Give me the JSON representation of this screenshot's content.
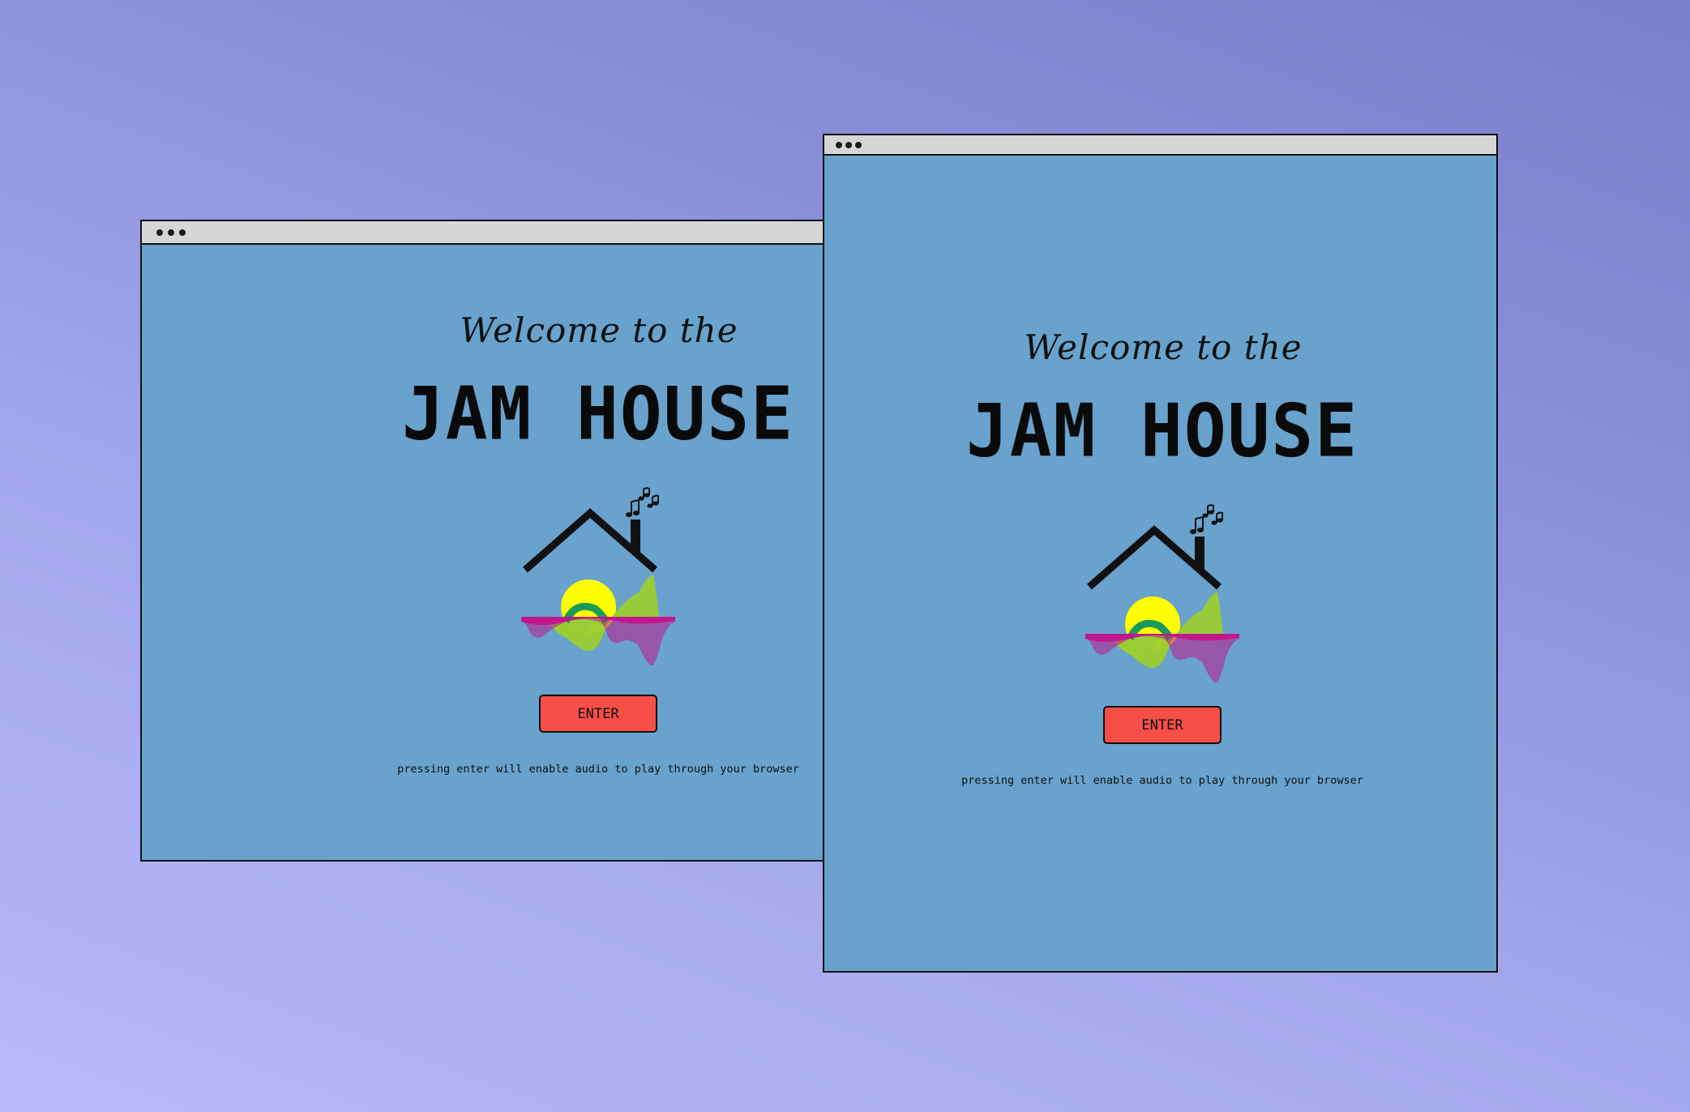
{
  "windows": [
    {
      "id": "left",
      "welcome_text": "Welcome to the",
      "title": "JAM HOUSE",
      "enter_label": "ENTER",
      "note": "pressing enter will enable audio to play through your browser"
    },
    {
      "id": "right",
      "welcome_text": "Welcome to the",
      "title": "JAM HOUSE",
      "enter_label": "ENTER",
      "note": "pressing enter will enable audio to play through your browser"
    }
  ],
  "icons": {
    "title_bar_controls": "window-dots-icon",
    "logo": "jam-house-logo-icon"
  },
  "colors": {
    "page_background_start": "#b9b9fc",
    "page_background_end": "#7b80cc",
    "window_background": "#68a2cd",
    "title_bar": "#d6d6d6",
    "enter_button": "#f64f47",
    "logo_sun": "#ffff00",
    "logo_hill": "#9acd32",
    "logo_wave": "#c0188c",
    "logo_teal": "#1a9a5a"
  }
}
